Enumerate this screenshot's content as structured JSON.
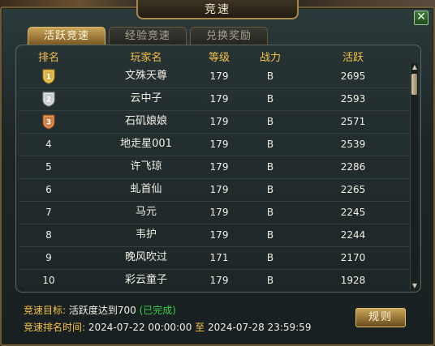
{
  "window": {
    "title": "竞速",
    "close_label": "✕"
  },
  "tabs": [
    {
      "label": "活跃竞速",
      "active": true
    },
    {
      "label": "经验竞速",
      "active": false
    },
    {
      "label": "兑换奖励",
      "active": false
    }
  ],
  "table": {
    "headers": {
      "rank": "排名",
      "name": "玩家名",
      "level": "等级",
      "power": "战力",
      "activity": "活跃"
    },
    "rows": [
      {
        "rank": "1",
        "medal": "gold",
        "name": "文殊天尊",
        "level": "179",
        "power": "B",
        "activity": "2695"
      },
      {
        "rank": "2",
        "medal": "silver",
        "name": "云中子",
        "level": "179",
        "power": "B",
        "activity": "2593"
      },
      {
        "rank": "3",
        "medal": "bronze",
        "name": "石矶娘娘",
        "level": "179",
        "power": "B",
        "activity": "2571"
      },
      {
        "rank": "4",
        "medal": "",
        "name": "地走星001",
        "level": "179",
        "power": "B",
        "activity": "2539"
      },
      {
        "rank": "5",
        "medal": "",
        "name": "许飞琼",
        "level": "179",
        "power": "B",
        "activity": "2286"
      },
      {
        "rank": "6",
        "medal": "",
        "name": "虬首仙",
        "level": "179",
        "power": "B",
        "activity": "2265"
      },
      {
        "rank": "7",
        "medal": "",
        "name": "马元",
        "level": "179",
        "power": "B",
        "activity": "2245"
      },
      {
        "rank": "8",
        "medal": "",
        "name": "韦护",
        "level": "179",
        "power": "B",
        "activity": "2244"
      },
      {
        "rank": "9",
        "medal": "",
        "name": "晚风吹过",
        "level": "171",
        "power": "B",
        "activity": "2170"
      },
      {
        "rank": "10",
        "medal": "",
        "name": "彩云童子",
        "level": "179",
        "power": "B",
        "activity": "1928"
      }
    ]
  },
  "info": {
    "goal_label": "竞速目标:",
    "goal_value": "活跃度达到700",
    "goal_status": "(已完成)",
    "time_label": "竞速排名时间:",
    "time_start": "2024-07-22 00:00:00",
    "time_sep": "至",
    "time_end": "2024-07-28 23:59:59"
  },
  "buttons": {
    "rules": "规则"
  },
  "colors": {
    "header": "#f4c24a",
    "accent_gold": "#c9a457",
    "completed": "#3ad04a",
    "text": "#f2efe4"
  }
}
